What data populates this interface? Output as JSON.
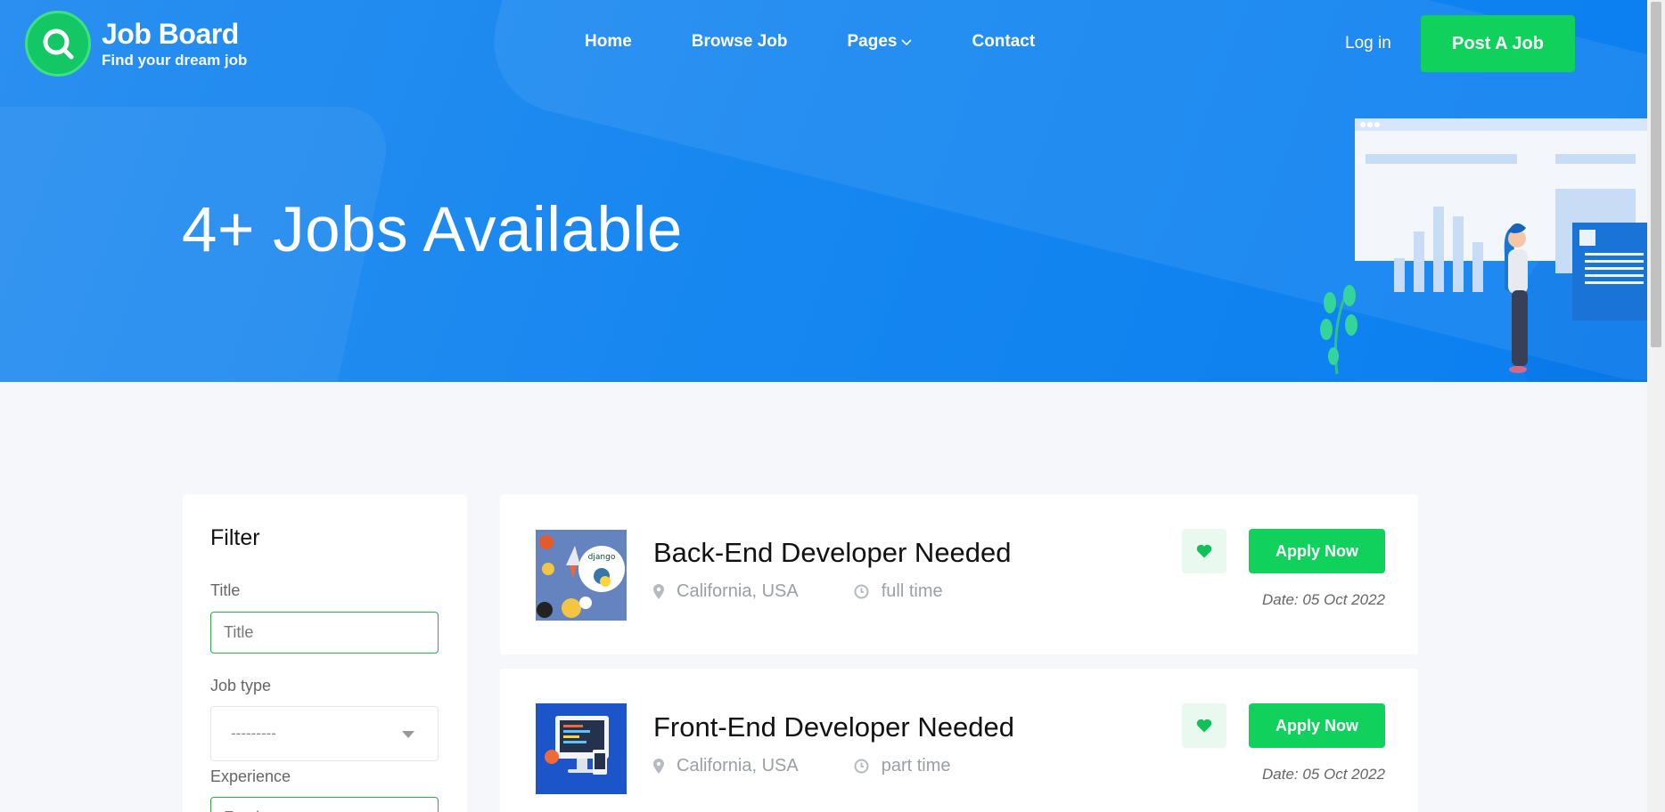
{
  "brand": {
    "name": "Job Board",
    "tagline": "Find your dream job"
  },
  "nav": {
    "items": [
      {
        "label": "Home"
      },
      {
        "label": "Browse Job"
      },
      {
        "label": "Pages"
      },
      {
        "label": "Contact"
      }
    ],
    "login_label": "Log in",
    "post_job_label": "Post A Job"
  },
  "hero": {
    "title": "4+ Jobs Available"
  },
  "filter": {
    "heading": "Filter",
    "title_label": "Title",
    "title_placeholder": "Title",
    "job_type_label": "Job type",
    "job_type_value": "---------",
    "experience_label": "Experience",
    "experience_value": "Fresher"
  },
  "jobs": [
    {
      "title": "Back-End Developer Needed",
      "location": "California, USA",
      "type": "full time",
      "date": "Date: 05 Oct 2022",
      "apply_label": "Apply Now",
      "thumb_icon": "python-django-thumbnail"
    },
    {
      "title": "Front-End Developer Needed",
      "location": "California, USA",
      "type": "part time",
      "date": "Date: 05 Oct 2022",
      "apply_label": "Apply Now",
      "thumb_icon": "frontend-monitor-thumbnail"
    }
  ],
  "colors": {
    "hero_blue": "#1787f0",
    "accent_green": "#0fd15c",
    "input_border": "#2eac4a"
  }
}
